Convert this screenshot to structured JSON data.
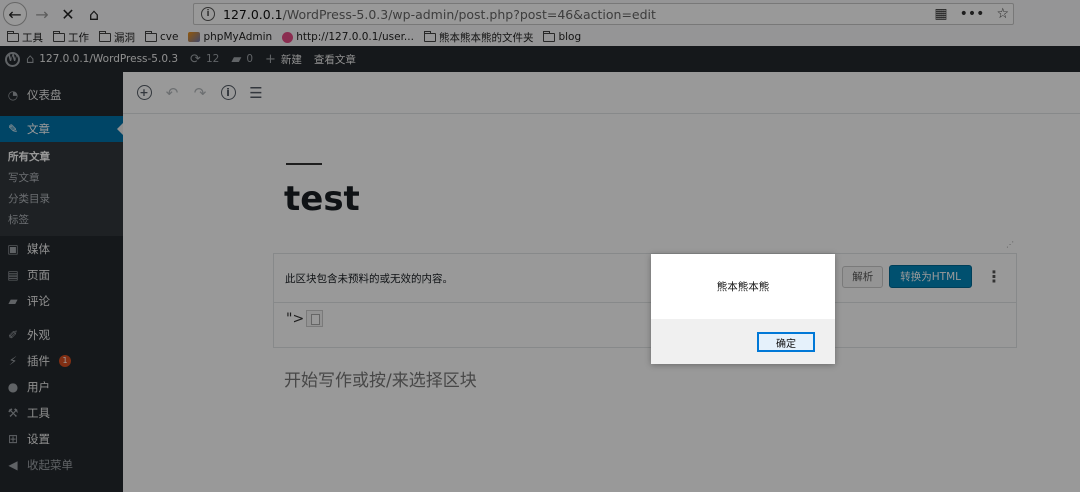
{
  "browser": {
    "back_icon": "back-arrow-icon",
    "forward_icon": "forward-arrow-icon",
    "stop_icon": "stop-icon",
    "home_icon": "home-icon",
    "url_host": "127.0.0.1",
    "url_path": "/WordPress-5.0.3/wp-admin/post.php?post=46&action=edit",
    "menu_dots": "•••"
  },
  "bookmarks": [
    {
      "label": "工具",
      "icon": "folder-icon"
    },
    {
      "label": "工作",
      "icon": "folder-icon"
    },
    {
      "label": "漏洞",
      "icon": "folder-icon"
    },
    {
      "label": "cve",
      "icon": "folder-icon"
    },
    {
      "label": "phpMyAdmin",
      "icon": "phpmyadmin-icon"
    },
    {
      "label": "http://127.0.0.1/user...",
      "icon": "site-icon"
    },
    {
      "label": "熊本熊本熊的文件夹",
      "icon": "folder-icon"
    },
    {
      "label": "blog",
      "icon": "folder-icon"
    }
  ],
  "admin_bar": {
    "site_name": "127.0.0.1/WordPress-5.0.3",
    "updates_count": "12",
    "comments_count": "0",
    "new_label": "新建",
    "view_post_label": "查看文章"
  },
  "sidebar": {
    "dashboard": "仪表盘",
    "posts": "文章",
    "submenu": [
      "所有文章",
      "写文章",
      "分类目录",
      "标签"
    ],
    "media": "媒体",
    "pages": "页面",
    "comments": "评论",
    "appearance": "外观",
    "plugins": "插件",
    "plugins_badge": "1",
    "users": "用户",
    "tools": "工具",
    "settings": "设置",
    "collapse": "收起菜单"
  },
  "editor": {
    "post_title": "test",
    "block_warning": "此区块包含未预料的或无效的内容。",
    "resolve_button": "解析",
    "convert_button": "转换为HTML",
    "block_content": "\">",
    "placeholder": "开始写作或按/来选择区块"
  },
  "dialog": {
    "message": "熊本熊本熊",
    "ok_button": "确定"
  }
}
